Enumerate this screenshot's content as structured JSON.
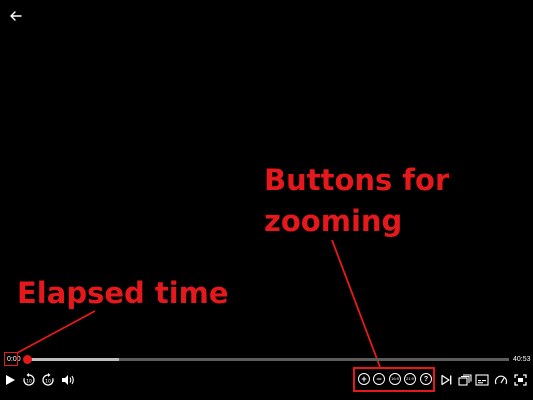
{
  "annotations": {
    "zoom_label_line1": "Buttons for",
    "zoom_label_line2": "zooming",
    "elapsed_label": "Elapsed time",
    "color": "#e5191c"
  },
  "player": {
    "elapsed_time": "0:00",
    "total_time": "40:53",
    "progress_fraction": 0.0,
    "buffered_fraction": 0.19,
    "accent_color": "#e5191c"
  },
  "controls": {
    "left": [
      "back-arrow-icon",
      "play-icon",
      "rewind-10-icon",
      "forward-10-icon",
      "volume-icon"
    ],
    "zoom": {
      "zoom_in": "+",
      "zoom_out": "−",
      "ratio_1": "16:9",
      "ratio_2": "21:9",
      "help": "?"
    },
    "right": [
      "next-episode-icon",
      "episodes-icon",
      "subtitles-icon",
      "speed-icon",
      "fullscreen-icon"
    ]
  }
}
